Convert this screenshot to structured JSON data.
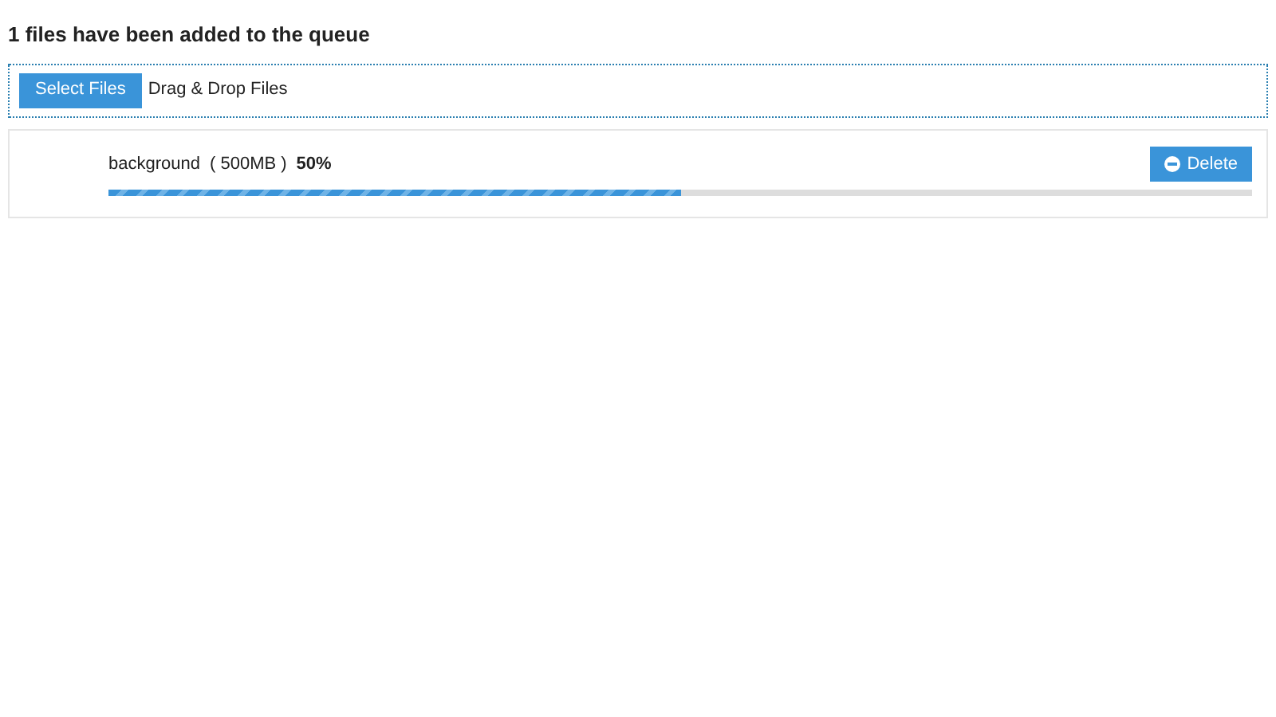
{
  "heading": "1 files have been added to the queue",
  "dropzone": {
    "button": "Select Files",
    "label": "Drag & Drop Files"
  },
  "files": [
    {
      "name": "background",
      "size": "( 500MB )",
      "percent": "50%",
      "level": 0.5,
      "button": "Delete"
    }
  ]
}
